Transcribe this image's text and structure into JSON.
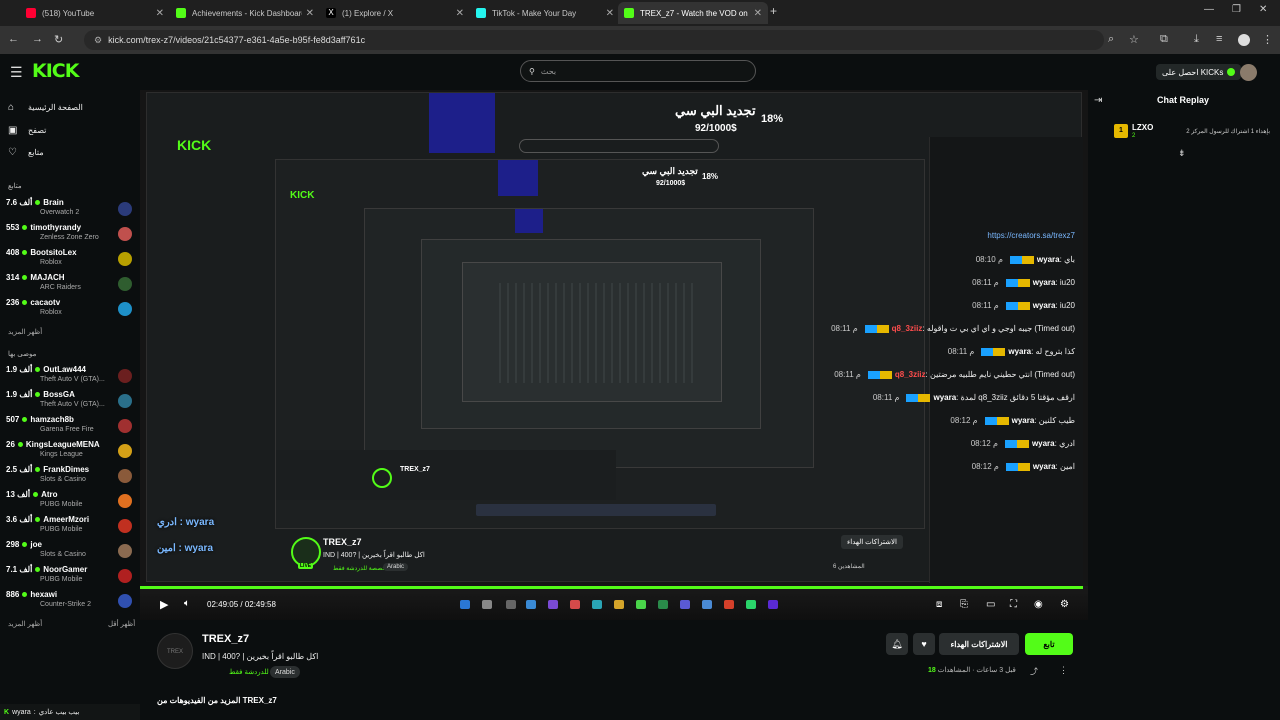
{
  "browser": {
    "tabs": [
      {
        "title": "(518) YouTube",
        "color": "#ff0033"
      },
      {
        "title": "Achievements - Kick Dashboard",
        "color": "#53fc18"
      },
      {
        "title": "(1) Explore / X",
        "color": "#ffffff"
      },
      {
        "title": "TikTok - Make Your Day",
        "color": "#25f4ee"
      },
      {
        "title": "TREX_z7 - Watch the VOD on K",
        "color": "#53fc18"
      }
    ],
    "url": "kick.com/trex-z7/videos/21c54377-e361-4a5e-b95f-fe8d3aff761c"
  },
  "header": {
    "logo": "KICK",
    "search_placeholder": "بحث",
    "get_kicks": "احصل على KICKs"
  },
  "sidebar": {
    "nav": [
      {
        "label": "الصفحة الرئيسية",
        "icon": "home-icon"
      },
      {
        "label": "تصفح",
        "icon": "browse-icon"
      },
      {
        "label": "متابع",
        "icon": "heart-icon"
      }
    ],
    "following_heading": "متابع",
    "following": [
      {
        "name": "Brain",
        "viewers": "7.6 ألف",
        "game": "Overwatch 2",
        "avatar": "#2b3b7a"
      },
      {
        "name": "timothyrandy",
        "viewers": "553",
        "game": "Zenless Zone Zero",
        "avatar": "#c0504d"
      },
      {
        "name": "BootsitoLex",
        "viewers": "408",
        "game": "Roblox",
        "avatar": "#b8a000"
      },
      {
        "name": "MAJACH",
        "viewers": "314",
        "game": "ARC Raiders",
        "avatar": "#2f5d2f"
      },
      {
        "name": "cacaotv",
        "viewers": "236",
        "game": "Roblox",
        "avatar": "#1e90c8"
      }
    ],
    "show_more_1": "أظهر المزيد",
    "recommended_heading": "موصى بها",
    "recommended": [
      {
        "name": "OutLaw444",
        "viewers": "1.9 ألف",
        "game": "Theft Auto V (GTA)...",
        "avatar": "#6b1f1f"
      },
      {
        "name": "BossGA",
        "viewers": "1.9 ألف",
        "game": "Theft Auto V (GTA)...",
        "avatar": "#2a6f8a"
      },
      {
        "name": "hamzach8b",
        "viewers": "507",
        "game": "Garena Free Fire",
        "avatar": "#a03030"
      },
      {
        "name": "KingsLeagueMENA",
        "viewers": "26",
        "game": "Kings League",
        "avatar": "#d4a017"
      },
      {
        "name": "FrankDimes",
        "viewers": "2.5 ألف",
        "game": "Slots & Casino",
        "avatar": "#8a5a3a"
      },
      {
        "name": "Atro",
        "viewers": "13 ألف",
        "game": "PUBG Mobile",
        "avatar": "#e07020"
      },
      {
        "name": "AmeerMzori",
        "viewers": "3.6 ألف",
        "game": "PUBG Mobile",
        "avatar": "#c03020"
      },
      {
        "name": "joe",
        "viewers": "298",
        "game": "Slots & Casino",
        "avatar": "#8a6a50"
      },
      {
        "name": "NoorGamer",
        "viewers": "7.1 ألف",
        "game": "PUBG Mobile",
        "avatar": "#b02020"
      },
      {
        "name": "hexawi",
        "viewers": "886",
        "game": "Counter-Strike 2",
        "avatar": "#3050b0"
      }
    ],
    "show_more_2": "أظهر المزيد",
    "show_less": "أظهر أقل"
  },
  "player": {
    "overlay_title": "تجديد البي سي",
    "overlay_progress": "92/1000$",
    "overlay_percent": "18%",
    "nested_chat": [
      {
        "time": "08:10 م",
        "user": "wyara",
        "text": "باي"
      },
      {
        "time": "08:11 م",
        "user": "wyara",
        "text": "iu20"
      },
      {
        "time": "08:11 م",
        "user": "wyara",
        "text": "iu20"
      },
      {
        "time": "08:11 م",
        "user": "q8_3ziiz",
        "text": "جيبه اوجي و اي اي بي ت واقوله (Timed out)",
        "red": true
      },
      {
        "time": "08:11 م",
        "user": "wyara",
        "text": "كذا بتروح له"
      },
      {
        "time": "08:11 م",
        "user": "q8_3ziiz",
        "text": "انتي حطيني نايم طلبيه مرضتين (Timed out)",
        "red": true
      },
      {
        "time": "08:11 م",
        "user": "wyara",
        "text": "لمدة q8_3ziiz ارقف مؤقتا 5 دقائق"
      },
      {
        "time": "08:12 م",
        "user": "wyara",
        "text": "طيب كلنين"
      },
      {
        "time": "08:12 م",
        "user": "wyara",
        "text": "ادري"
      },
      {
        "time": "08:12 م",
        "user": "wyara",
        "text": "امين"
      }
    ],
    "nested_streamer": "TREX_z7",
    "nested_title": "IND | 400? | اكل طالبو اقراً بخيرين",
    "nested_cat": "مخصصة للدردشة فقط",
    "nested_tag": "Arabic",
    "nested_live": "LIVE",
    "nested_subs": "الاشتراكات الهداء",
    "nested_viewers": "المشاهدين 6",
    "nested_chat_pin_link": "https://creators.sa/trexz7",
    "overlay_chat": [
      {
        "user": "wyara",
        "text": "ادري"
      },
      {
        "user": "wyara",
        "text": "امين"
      }
    ],
    "time_current": "02:49:05",
    "time_total": "02:49:58",
    "progress": 0.995
  },
  "chat": {
    "title": "Chat Replay",
    "pinned": {
      "badge": "1",
      "name": "LZXO",
      "count": "2",
      "text": "بإهداء 1 اشتراك للرسول المركز 2"
    }
  },
  "info": {
    "streamer": "TREX_z7",
    "title": "IND | 400? | اكل طالبو اقراً بخيرين",
    "category": "مخصصة للدردشة فقط",
    "tag": "Arabic",
    "follow": "تابع",
    "subscribe": "الاشتراكات الهداء",
    "views_label": "المشاهدات",
    "views": "18",
    "ago": "قبل 3 ساعات",
    "more_videos": "المزيد من الفيديوهات من TREX_z7"
  },
  "toast": {
    "user": "wyara",
    "text": "بيب بيب عادي"
  }
}
